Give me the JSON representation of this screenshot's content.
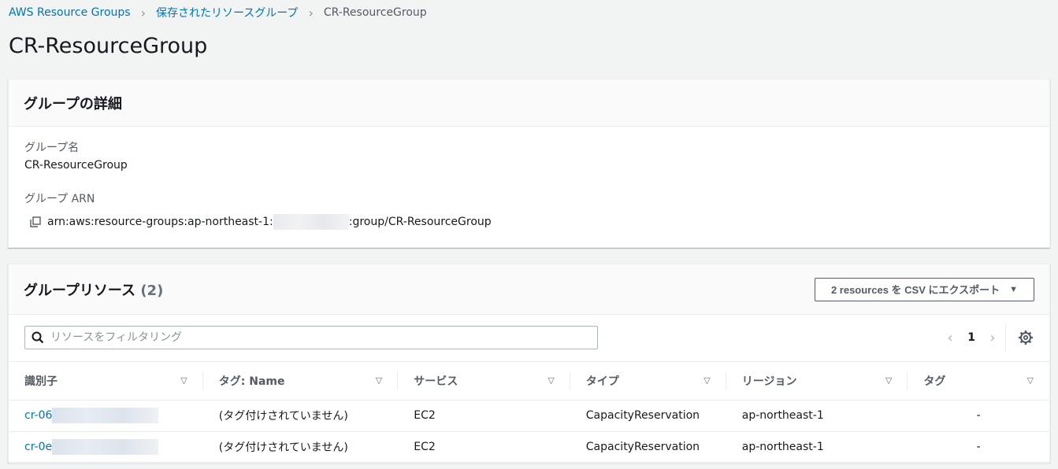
{
  "breadcrumb": {
    "items": [
      "AWS Resource Groups",
      "保存されたリソースグループ"
    ],
    "current": "CR-ResourceGroup"
  },
  "page_title": "CR-ResourceGroup",
  "details": {
    "heading": "グループの詳細",
    "name_label": "グループ名",
    "name_value": "CR-ResourceGroup",
    "arn_label": "グループ ARN",
    "arn_prefix": "arn:aws:resource-groups:ap-northeast-1:",
    "arn_suffix": ":group/CR-ResourceGroup"
  },
  "resources": {
    "heading": "グループリソース",
    "count": "(2)",
    "export_label": "2 resources を CSV にエクスポート",
    "search_placeholder": "リソースをフィルタリング",
    "page": "1",
    "columns": [
      "識別子",
      "タグ: Name",
      "サービス",
      "タイプ",
      "リージョン",
      "タグ"
    ],
    "rows": [
      {
        "id": "cr-06",
        "tag_name": "(タグ付けされていません)",
        "service": "EC2",
        "type": "CapacityReservation",
        "region": "ap-northeast-1",
        "tags": "-"
      },
      {
        "id": "cr-0e",
        "tag_name": "(タグ付けされていません)",
        "service": "EC2",
        "type": "CapacityReservation",
        "region": "ap-northeast-1",
        "tags": "-"
      }
    ]
  },
  "colors": {
    "link": "#0073bb",
    "background": "#f2f3f3",
    "text": "#16191f",
    "secondary": "#545b64"
  }
}
